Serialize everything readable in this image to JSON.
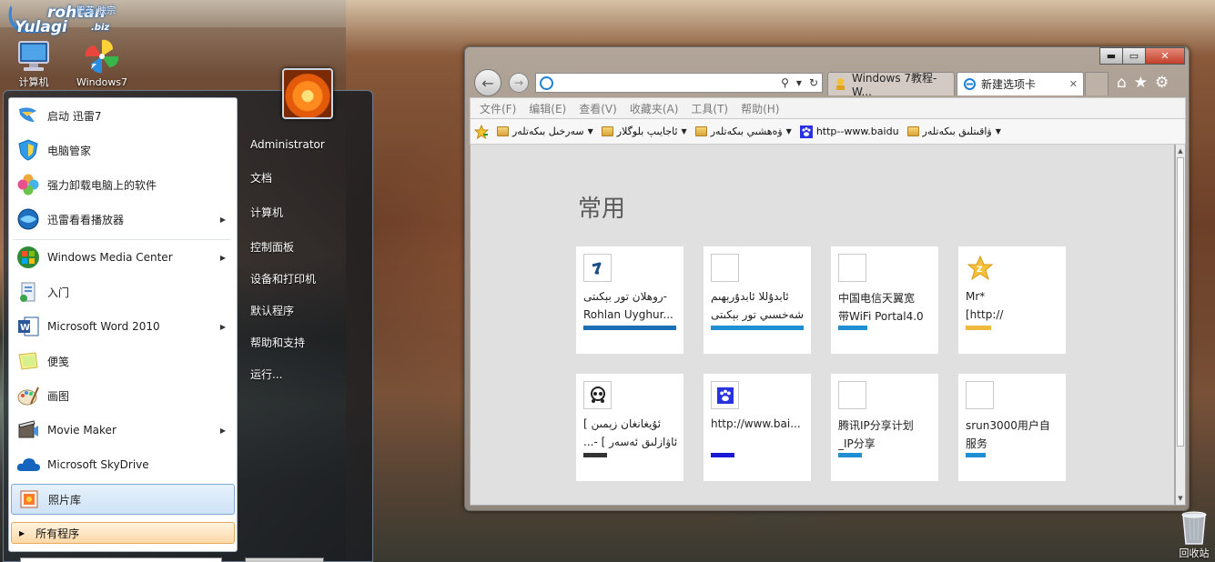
{
  "desktop": {
    "logo": {
      "line1": "rohtan",
      "line2": "Yulagi",
      "suffix": ".biz",
      "top_text": "巳芝 胦宗"
    },
    "icons": [
      {
        "label": "计算机",
        "icon": "computer-icon"
      },
      {
        "label": "Windows7",
        "icon": "windows-pinwheel-icon"
      },
      {
        "label": "回收站",
        "icon": "recycle-bin-icon"
      }
    ]
  },
  "start_menu": {
    "programs": [
      {
        "label": "启动 迅雷7",
        "icon": "thunder-icon",
        "submenu": false
      },
      {
        "label": "电脑管家",
        "icon": "shield-icon",
        "submenu": false
      },
      {
        "label": "强力卸载电脑上的软件",
        "icon": "clover-icon",
        "submenu": false
      },
      {
        "label": "迅雷看看播放器",
        "icon": "player-icon",
        "submenu": true
      },
      {
        "label": "Windows Media Center",
        "icon": "windows-logo-icon",
        "submenu": true
      },
      {
        "label": "入门",
        "icon": "getting-started-icon",
        "submenu": false
      },
      {
        "label": "Microsoft Word 2010",
        "icon": "word-icon",
        "submenu": true
      },
      {
        "label": "便笺",
        "icon": "sticky-note-icon",
        "submenu": false
      },
      {
        "label": "画图",
        "icon": "paint-icon",
        "submenu": false
      },
      {
        "label": "Movie Maker",
        "icon": "movie-maker-icon",
        "submenu": true
      },
      {
        "label": "Microsoft SkyDrive",
        "icon": "cloud-icon",
        "submenu": false
      },
      {
        "label": "照片库",
        "icon": "photo-gallery-icon",
        "submenu": false,
        "selected": true
      }
    ],
    "all_programs": "所有程序",
    "right": [
      "Administrator",
      "文档",
      "计算机",
      "控制面板",
      "设备和打印机",
      "默认程序",
      "帮助和支持",
      "运行..."
    ]
  },
  "browser": {
    "tabs": [
      {
        "label": "Windows 7教程-W...",
        "active": false
      },
      {
        "label": "新建选项卡",
        "active": true,
        "close": "✕"
      }
    ],
    "address_value": "",
    "address_icons": {
      "search": "⚲",
      "dropdown": "▾",
      "refresh": "↻"
    },
    "window_buttons": {
      "minimize": "▬",
      "maximize": "▭",
      "close": "✕"
    },
    "menu": [
      "文件(F)",
      "编辑(E)",
      "查看(V)",
      "收藏夹(A)",
      "工具(T)",
      "帮助(H)"
    ],
    "favorites": [
      {
        "label": "سەرخىل بىكەتلەر",
        "icon": "folder-icon"
      },
      {
        "label": "ئاجايىپ بلوگلار",
        "icon": "folder-icon"
      },
      {
        "label": "ۋەھشىي بىكەتلەر",
        "icon": "folder-icon"
      },
      {
        "label": "http--www.baidu",
        "icon": "baidu-paw-icon"
      },
      {
        "label": "ۋاقىتلىق بىكەتلەر",
        "icon": "folder-icon"
      }
    ],
    "frequent_title": "常用",
    "tiles": [
      {
        "line1": "-روھلان تور بېكىتى",
        "line2": "Rohlan Uyghur...",
        "bar": "#1b6fb5",
        "bar_w": 102,
        "icon": "rohlan-icon",
        "rtl1": true
      },
      {
        "line1": "ئابدۇللا ئابدۇرېھىم",
        "line2": "شەخسىي تور بېكىتى",
        "bar": "#1e8fd2",
        "bar_w": 102,
        "icon": "blank-icon",
        "rtl1": true,
        "rtl2": true
      },
      {
        "line1": "中国电信天翼宽",
        "line2": "带WiFi Portal4.0",
        "bar": "#1e8fd2",
        "bar_w": 32,
        "icon": "blank-icon"
      },
      {
        "line1": "Mr*",
        "line2": "[http://",
        "bar": "#f0b83c",
        "bar_w": 28,
        "icon": "star-icon"
      },
      {
        "line1": "ئۇيغانغان زېمىن ]",
        "line2": "ئاۋازلىق ئەسەر ] -...",
        "bar": "#333333",
        "bar_w": 26,
        "icon": "paw-dots-icon",
        "rtl1": true,
        "rtl2": true
      },
      {
        "line1": "http://www.bai...",
        "line2": "",
        "bar": "#1a1ad6",
        "bar_w": 26,
        "icon": "baidu-paw-icon"
      },
      {
        "line1": "腾讯IP分享计划",
        "line2": "_IP分享",
        "bar": "#1e8fd2",
        "bar_w": 26,
        "icon": "blank-icon"
      },
      {
        "line1": "srun3000用户自",
        "line2": "服务",
        "bar": "#1e8fd2",
        "bar_w": 22,
        "icon": "blank-icon"
      }
    ]
  }
}
